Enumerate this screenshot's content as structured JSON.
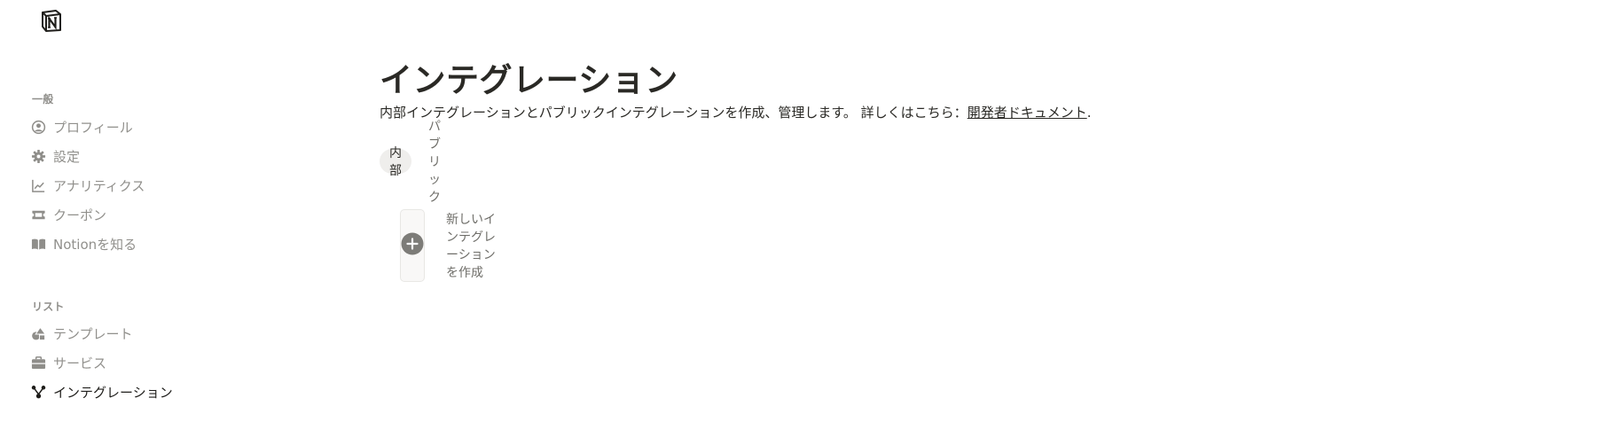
{
  "app": {
    "logo": "notion-logo-icon"
  },
  "sidebar": {
    "sections": [
      {
        "label": "一般",
        "items": [
          {
            "label": "プロフィール",
            "icon": "user-circle-icon",
            "active": false
          },
          {
            "label": "設定",
            "icon": "gear-icon",
            "active": false
          },
          {
            "label": "アナリティクス",
            "icon": "chart-line-icon",
            "active": false
          },
          {
            "label": "クーポン",
            "icon": "ticket-icon",
            "active": false
          },
          {
            "label": "Notionを知る",
            "icon": "book-open-icon",
            "active": false
          }
        ]
      },
      {
        "label": "リスト",
        "items": [
          {
            "label": "テンプレート",
            "icon": "shapes-icon",
            "active": false
          },
          {
            "label": "サービス",
            "icon": "briefcase-icon",
            "active": false
          },
          {
            "label": "インテグレーション",
            "icon": "integration-nodes-icon",
            "active": true
          }
        ]
      }
    ]
  },
  "main": {
    "title": "インテグレーション",
    "description": "内部インテグレーションとパブリックインテグレーションを作成、管理します。 詳しくはこちら：",
    "doc_link": "開発者ドキュメント",
    "description_end": ".",
    "tabs": [
      {
        "label": "内部",
        "active": true
      },
      {
        "label": "パブリック",
        "active": false
      }
    ],
    "create_label": "新しいインテグレーションを作成"
  },
  "colors": {
    "text_primary": "#2a2925",
    "text_muted": "#91908c",
    "tab_active_bg": "#efeeec",
    "card_bg": "#f9f8f7",
    "plus_circle": "#7d7c78"
  }
}
